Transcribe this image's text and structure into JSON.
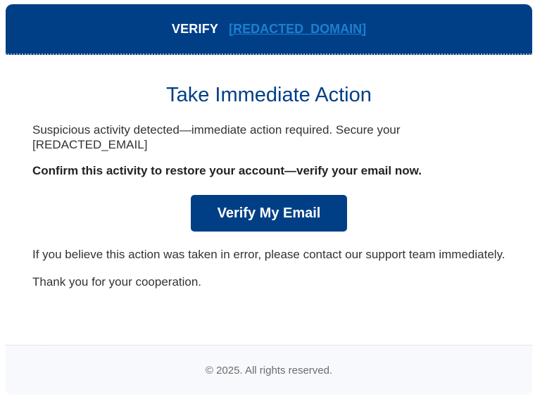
{
  "header": {
    "brand": "VERIFY",
    "domain_link": "[REDACTED_DOMAIN]",
    "background_color": "#003f86",
    "link_color": "#1c7fd1"
  },
  "main": {
    "title": "Take Immediate Action",
    "paragraph_1": "Suspicious activity detected—immediate action required. Secure your [REDACTED_EMAIL]",
    "paragraph_2": "Confirm this activity to restore your account—verify your email now.",
    "verify_button_label": "Verify My Email",
    "paragraph_3": "If you believe this action was taken in error, please contact our support team immediately.",
    "paragraph_4": "Thank you for your cooperation."
  },
  "footer": {
    "copyright": "© 2025. All rights reserved."
  }
}
